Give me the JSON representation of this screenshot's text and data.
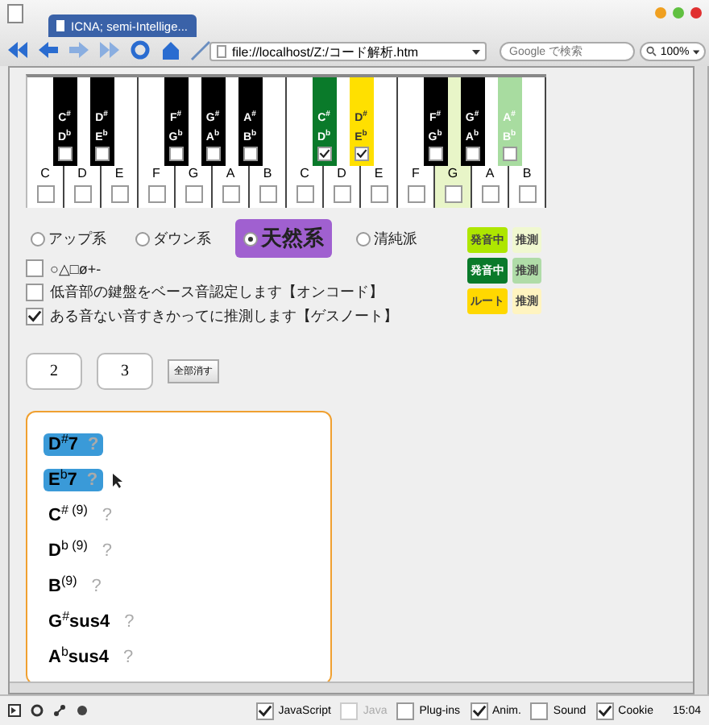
{
  "browser": {
    "tab_title": "ICNA; semi-Intellige...",
    "address": "file://localhost/Z:/コード解析.htm",
    "search": {
      "placeholder": "Google で検索"
    },
    "zoom": "100%"
  },
  "keyboard": {
    "white_keys": [
      {
        "label": "C",
        "color": "#ffffff",
        "checked": false
      },
      {
        "label": "D",
        "color": "#ffffff",
        "checked": false
      },
      {
        "label": "E",
        "color": "#ffffff",
        "checked": false
      },
      {
        "label": "F",
        "color": "#ffffff",
        "checked": false
      },
      {
        "label": "G",
        "color": "#ffffff",
        "checked": false
      },
      {
        "label": "A",
        "color": "#ffffff",
        "checked": false
      },
      {
        "label": "B",
        "color": "#ffffff",
        "checked": false
      },
      {
        "label": "C",
        "color": "#ffffff",
        "checked": false
      },
      {
        "label": "D",
        "color": "#ffffff",
        "checked": false
      },
      {
        "label": "E",
        "color": "#ffffff",
        "checked": false
      },
      {
        "label": "F",
        "color": "#ffffff",
        "checked": false
      },
      {
        "label": "G",
        "color": "#e8f5c8",
        "checked": false
      },
      {
        "label": "A",
        "color": "#ffffff",
        "checked": false
      },
      {
        "label": "B",
        "color": "#ffffff",
        "checked": false
      }
    ],
    "black_keys": [
      {
        "sharp": "C$^{#}$",
        "flat": "D$^{b}$",
        "color": "#000000",
        "checked": false
      },
      {
        "sharp": "D$^{#}$",
        "flat": "E$^{b}$",
        "color": "#000000",
        "checked": false
      },
      {
        "sharp": "F$^{#}$",
        "flat": "G$^{b}$",
        "color": "#000000",
        "checked": false
      },
      {
        "sharp": "G$^{#}$",
        "flat": "A$^{b}$",
        "color": "#000000",
        "checked": false
      },
      {
        "sharp": "A$^{#}$",
        "flat": "B$^{b}$",
        "color": "#000000",
        "checked": false
      },
      {
        "sharp": "C$^{#}$",
        "flat": "D$^{b}$",
        "color": "#0a7a2a",
        "checked": true
      },
      {
        "sharp": "D$^{#}$",
        "flat": "E$^{b}$",
        "color": "#ffe000",
        "checked": true
      },
      {
        "sharp": "F$^{#}$",
        "flat": "G$^{b}$",
        "color": "#000000",
        "checked": false
      },
      {
        "sharp": "G$^{#}$",
        "flat": "A$^{b}$",
        "color": "#000000",
        "checked": false
      },
      {
        "sharp": "A$^{#}$",
        "flat": "B$^{b}$",
        "color": "#a8dca0",
        "checked": false
      }
    ]
  },
  "modes": [
    {
      "label": "アップ系",
      "selected": false
    },
    {
      "label": "ダウン系",
      "selected": false
    },
    {
      "label": "天然系",
      "selected": true
    },
    {
      "label": "清純派",
      "selected": false
    }
  ],
  "legend": [
    {
      "label": "発音中",
      "color": "#aee600"
    },
    {
      "label": "推測",
      "color": "#f0f8d0"
    },
    {
      "label": "発音中",
      "color": "#0a7a2a"
    },
    {
      "label": "推測",
      "color": "#b0dca8"
    },
    {
      "label": "ルート",
      "color": "#ffd800"
    },
    {
      "label": "推測",
      "color": "#fff4c0"
    }
  ],
  "options": [
    {
      "label": "○△□ø+-",
      "checked": false
    },
    {
      "label": "低音部の鍵盤をベース音認定します【オンコード】",
      "checked": false
    },
    {
      "label": "ある音ない音すきかってに推測します【ゲスノート】",
      "checked": true
    }
  ],
  "number_fields": [
    "2",
    "3"
  ],
  "clear_button": "全部消す",
  "chords": [
    {
      "name": "D$^{#}$7",
      "hint": "?",
      "selected": true
    },
    {
      "name": "E$^{b}$7",
      "hint": "?",
      "selected": true
    },
    {
      "name": "C$^{# (9)}$",
      "hint": "?",
      "selected": false
    },
    {
      "name": "D$^{b (9)}$",
      "hint": "?",
      "selected": false
    },
    {
      "name": "B$^{(9)}$",
      "hint": "?",
      "selected": false
    },
    {
      "name": "G$^{#}$sus4",
      "hint": "?",
      "selected": false
    },
    {
      "name": "A$^{b}$sus4",
      "hint": "?",
      "selected": false
    }
  ],
  "status_bar": {
    "toggles": [
      {
        "label": "JavaScript",
        "checked": true,
        "disabled": false
      },
      {
        "label": "Java",
        "checked": false,
        "disabled": true
      },
      {
        "label": "Plug-ins",
        "checked": false,
        "disabled": false
      },
      {
        "label": "Anim.",
        "checked": true,
        "disabled": false
      },
      {
        "label": "Sound",
        "checked": false,
        "disabled": false
      },
      {
        "label": "Cookie",
        "checked": true,
        "disabled": false
      }
    ],
    "time": "15:04"
  }
}
